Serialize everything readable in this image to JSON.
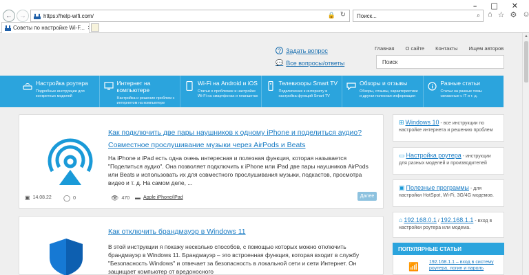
{
  "browser": {
    "url": "https://help-wifi.com/",
    "search_placeholder": "Поиск...",
    "tab_title": "Советы по настройке Wi-F..."
  },
  "header": {
    "ask_question": "Задать вопрос",
    "all_questions": "Все вопросы/ответы",
    "top_links": [
      "Главная",
      "О сайте",
      "Контакты",
      "Ищем авторов"
    ],
    "search_placeholder": "Поиск"
  },
  "nav": [
    {
      "title": "Настройка роутера",
      "desc": "Подробные инструкции для конкретных моделей",
      "icon": "router-icon"
    },
    {
      "title": "Интернет на компьютере",
      "desc": "Настройка и решение проблем с интернетом на компьютере",
      "icon": "monitor-icon"
    },
    {
      "title": "Wi-Fi на Android и iOS",
      "desc": "Статьи о проблемах и настройке Wi-Fi на смартфонах и планшетах",
      "icon": "phone-icon"
    },
    {
      "title": "Телевизоры Smart TV",
      "desc": "Подключение к интернету и настройка функций Smart TV",
      "icon": "remote-icon"
    },
    {
      "title": "Обзоры и отзывы",
      "desc": "Обзоры, отзывы, характеристики и другая полезная информация",
      "icon": "chat-icon"
    },
    {
      "title": "Разные статьи",
      "desc": "Статьи на разные темы связанные с IT и т. д.",
      "icon": "info-icon"
    }
  ],
  "articles": [
    {
      "title": "Как подключить две пары наушников к одному iPhone и поделиться аудио? Совместное прослушивание музыки через AirPods и Beats",
      "excerpt": "На iPhone и iPad есть одна очень интересная и полезная функция, которая называется \"Поделиться аудио\". Она позволяет подключить к iPhone или iPad две пары наушников AirPods или Beats и использовать их для совместного прослушивания музыки, подкастов, просмотра видео и т. д. На самом деле, ...",
      "date": "14.08.22",
      "comments": "0",
      "views": "470",
      "category": "Apple iPhone/iPad",
      "more": "Далее"
    },
    {
      "title": "Как отключить брандмауэр в Windows 11",
      "excerpt": "В этой инструкции я покажу несколько способов, с помощью которых можно отключить брандмауэр в Windows 11. Брандмауэр – это встроенная функция, которая входит в службу \"Безопасность Windows\" и отвечает за безопасность в локальной сети и сети Интернет. Он защищает компьютер от вредоносного"
    }
  ],
  "sidebar": [
    {
      "link": "Windows 10",
      "text": " - все инструкции по настройке интернета и решению проблем"
    },
    {
      "link": "Настройка роутера",
      "text": " - инструкции для разных моделей и производителей"
    },
    {
      "link": "Полезные программы",
      "text": " - для настройки HotSpot, Wi-Fi, 3G/4G модемов."
    },
    {
      "link": "192.168.0.1",
      "link2": "192.168.1.1",
      "sep": " / ",
      "text": " - вход в настройки роутера или модема."
    }
  ],
  "popular": {
    "heading": "ПОПУЛЯРНЫЕ СТАТЬИ",
    "first": "192.168.1.1 – вход в систему роутера, логин и пароль"
  }
}
